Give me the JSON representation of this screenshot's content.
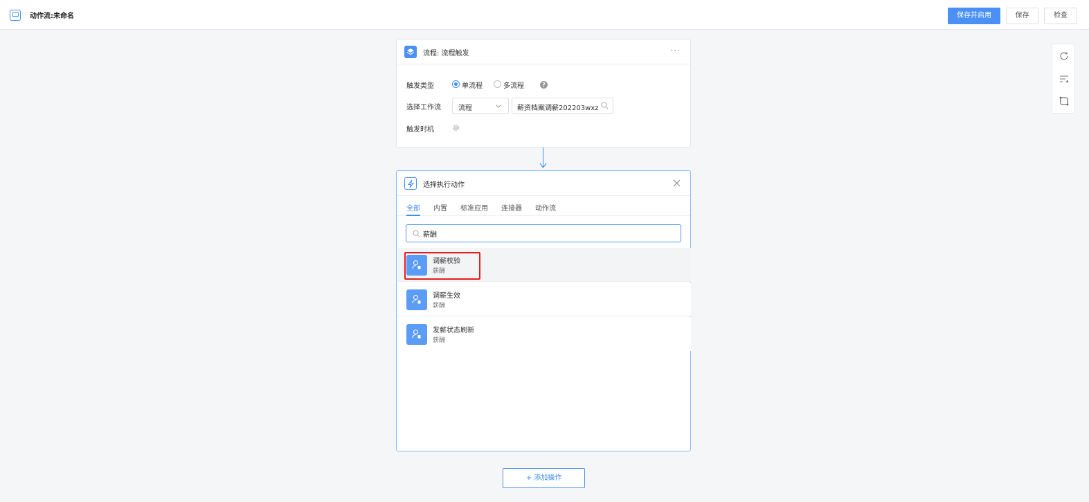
{
  "header": {
    "title": "动作流:未命名",
    "save_publish_label": "保存并启用",
    "save_label": "保存",
    "check_label": "检查"
  },
  "trigger_card": {
    "title": "流程: 流程触发",
    "more": "···",
    "trigger_type_label": "触发类型",
    "radio_single": "单流程",
    "radio_multi": "多流程",
    "select_workflow_label": "选择工作流",
    "workflow_select_value": "流程",
    "workflow_value": "薪资档案调薪202203wxz",
    "trigger_time_label": "触发时机"
  },
  "action_card": {
    "title": "选择执行动作",
    "tabs": [
      "全部",
      "内置",
      "标准应用",
      "连接器",
      "动作流"
    ],
    "active_tab": "全部",
    "search_value": "薪酬",
    "results": [
      {
        "name": "调薪校验",
        "category": "薪酬"
      },
      {
        "name": "调薪生效",
        "category": "薪酬"
      },
      {
        "name": "发薪状态刷新",
        "category": "薪酬"
      }
    ]
  },
  "add_operation_label": "+ 添加操作",
  "colors": {
    "primary": "#4a90f5",
    "highlight": "#e32020",
    "background": "#f5f6f7"
  },
  "icons": {
    "app": "app-window-icon",
    "trigger": "layers-icon",
    "action": "bolt-icon",
    "result": "user-badge-icon",
    "tools": [
      "refresh-icon",
      "sort-icon",
      "frame-icon"
    ]
  }
}
